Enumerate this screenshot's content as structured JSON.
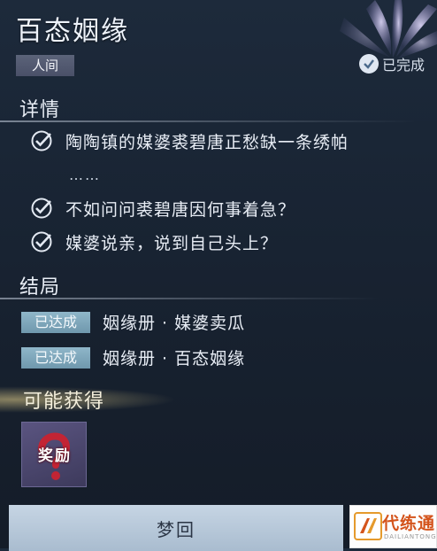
{
  "header": {
    "title": "百态姻缘",
    "realm_tag": "人间",
    "status_text": "已完成"
  },
  "details": {
    "label": "详情",
    "items": [
      {
        "text_line1": "陶陶镇的媒婆裘碧唐正愁缺一条绣帕",
        "text_line2": "……"
      },
      {
        "text": "不如问问裘碧唐因何事着急？"
      },
      {
        "text": "媒婆说亲，说到自己头上？"
      }
    ]
  },
  "ending": {
    "label": "结局",
    "items": [
      {
        "tag": "已达成",
        "text": "姻缘册 · 媒婆卖瓜"
      },
      {
        "tag": "已达成",
        "text": "姻缘册 · 百态姻缘"
      }
    ]
  },
  "rewards": {
    "label": "可能获得",
    "items": [
      {
        "text": "奖励"
      }
    ]
  },
  "actions": {
    "dream_button": "梦回"
  },
  "watermark": {
    "text": "代练通"
  },
  "colors": {
    "tag_realm": "#525a72",
    "tag_achieved": "#7fa7bb",
    "button": "#b8c9db",
    "background": "#1a2535"
  }
}
